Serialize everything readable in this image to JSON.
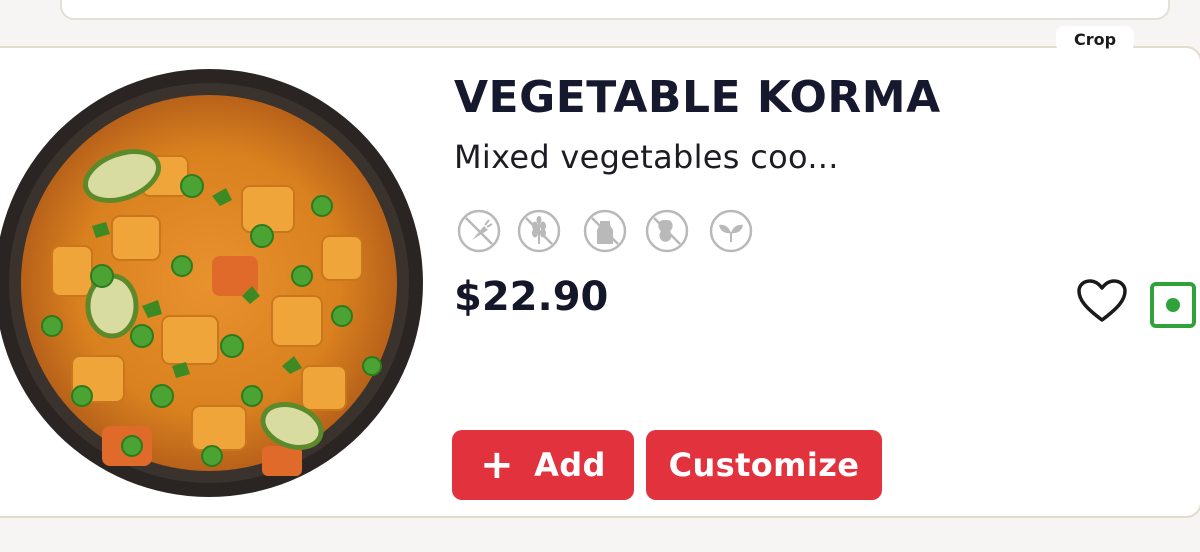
{
  "overlay": {
    "crop_label": "Crop"
  },
  "item": {
    "name": "VEGETABLE KORMA",
    "description": "Mixed vegetables coo...",
    "price": "$22.90",
    "image": "vegetable-korma-bowl",
    "allergens": [
      {
        "icon": "no-carrot-icon"
      },
      {
        "icon": "no-gluten-icon"
      },
      {
        "icon": "no-dairy-icon"
      },
      {
        "icon": "no-peanut-icon"
      },
      {
        "icon": "vegan-leaf-icon"
      }
    ],
    "is_vegetarian": true
  },
  "actions": {
    "add_icon": "+",
    "add_label": "Add",
    "customize_label": "Customize"
  },
  "colors": {
    "accent": "#e2323d",
    "veg_green": "#2fa33a",
    "text_dark": "#16182e"
  }
}
